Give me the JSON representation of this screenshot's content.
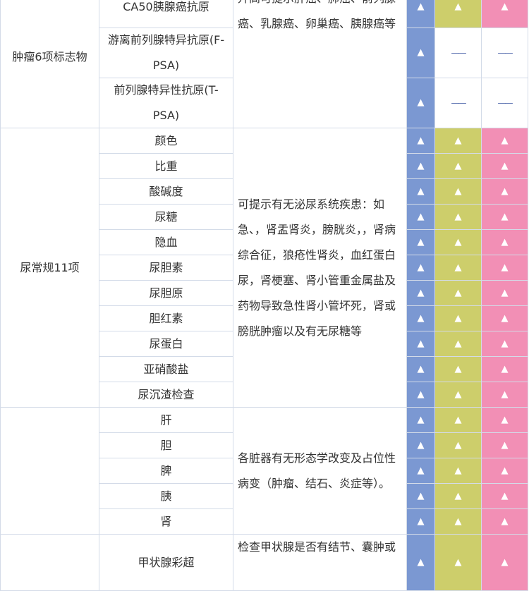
{
  "colors": {
    "blue": "#7b98d2",
    "yellow": "#cdce6b",
    "pink": "#f28fb5",
    "grid": "#d3dbe8",
    "dash": "#4a63a8"
  },
  "mark_symbol": "▲",
  "sections": [
    {
      "category": "肿瘤6项标志物",
      "description": "升高可提示肝癌、肺癌、前列腺癌、乳腺癌、卵巢癌、胰腺癌等",
      "items": [
        {
          "name": "CA50胰腺癌抗原",
          "packages": [
            "▲",
            "▲",
            "▲"
          ]
        },
        {
          "name": "游离前列腺特异抗原(F-PSA)",
          "packages": [
            "▲",
            "——",
            "——"
          ]
        },
        {
          "name": "前列腺特异性抗原(T-PSA)",
          "packages": [
            "▲",
            "——",
            "——"
          ]
        }
      ]
    },
    {
      "category": "尿常规11项",
      "description": "可提示有无泌尿系统疾患：如急、，肾盂肾炎，膀胱炎，，肾病综合征，狼疮性肾炎，血红蛋白尿，肾梗塞、肾小管重金属盐及药物导致急性肾小管坏死，肾或膀胱肿瘤以及有无尿糖等",
      "items": [
        {
          "name": "颜色",
          "packages": [
            "▲",
            "▲",
            "▲"
          ]
        },
        {
          "name": "比重",
          "packages": [
            "▲",
            "▲",
            "▲"
          ]
        },
        {
          "name": "酸碱度",
          "packages": [
            "▲",
            "▲",
            "▲"
          ]
        },
        {
          "name": "尿糖",
          "packages": [
            "▲",
            "▲",
            "▲"
          ]
        },
        {
          "name": "隐血",
          "packages": [
            "▲",
            "▲",
            "▲"
          ]
        },
        {
          "name": "尿胆素",
          "packages": [
            "▲",
            "▲",
            "▲"
          ]
        },
        {
          "name": "尿胆原",
          "packages": [
            "▲",
            "▲",
            "▲"
          ]
        },
        {
          "name": "胆红素",
          "packages": [
            "▲",
            "▲",
            "▲"
          ]
        },
        {
          "name": "尿蛋白",
          "packages": [
            "▲",
            "▲",
            "▲"
          ]
        },
        {
          "name": "亚硝酸盐",
          "packages": [
            "▲",
            "▲",
            "▲"
          ]
        },
        {
          "name": "尿沉渣检查",
          "packages": [
            "▲",
            "▲",
            "▲"
          ]
        }
      ]
    },
    {
      "category": "",
      "description": "各脏器有无形态学改变及占位性病变（肿瘤、结石、炎症等）。",
      "items": [
        {
          "name": "肝",
          "packages": [
            "▲",
            "▲",
            "▲"
          ]
        },
        {
          "name": "胆",
          "packages": [
            "▲",
            "▲",
            "▲"
          ]
        },
        {
          "name": "脾",
          "packages": [
            "▲",
            "▲",
            "▲"
          ]
        },
        {
          "name": "胰",
          "packages": [
            "▲",
            "▲",
            "▲"
          ]
        },
        {
          "name": "肾",
          "packages": [
            "▲",
            "▲",
            "▲"
          ]
        }
      ]
    },
    {
      "category": "",
      "description": "检查甲状腺是否有结节、囊肿或",
      "items": [
        {
          "name": "甲状腺彩超",
          "packages": [
            "▲",
            "▲",
            "▲"
          ]
        }
      ]
    }
  ]
}
